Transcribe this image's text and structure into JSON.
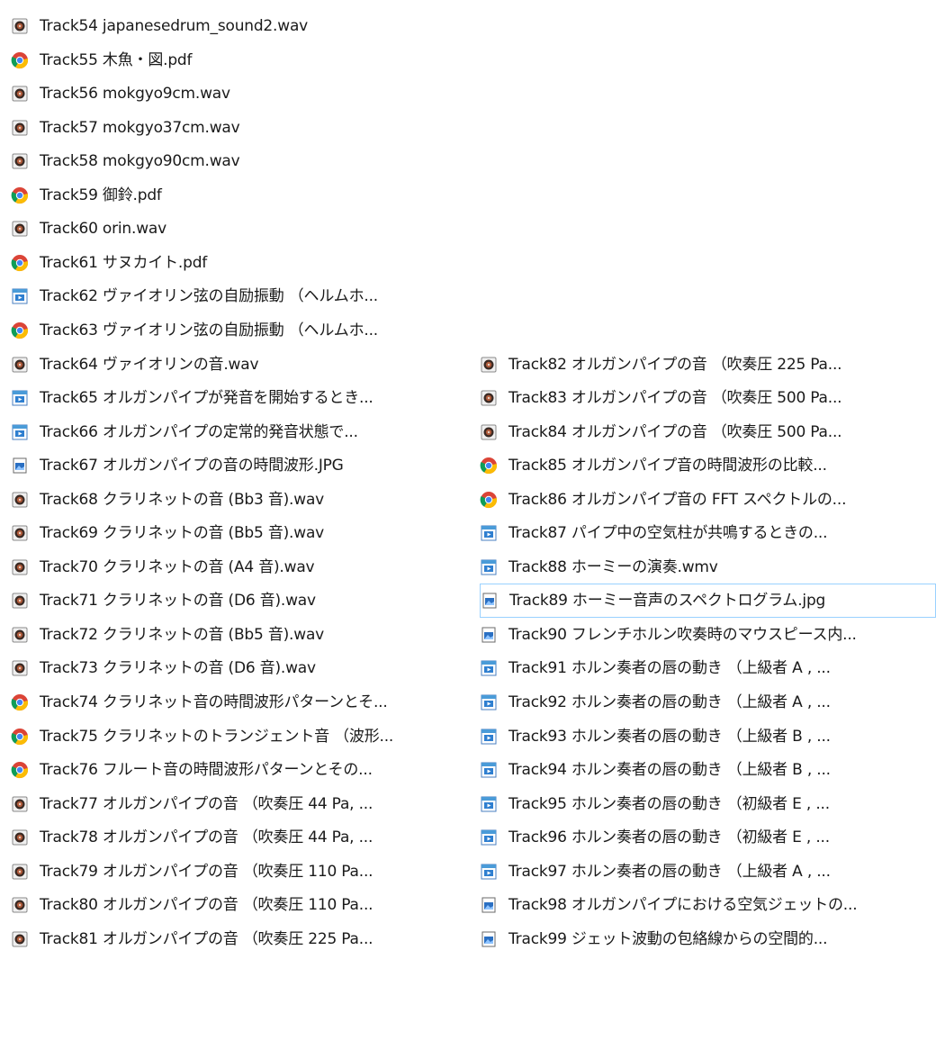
{
  "files": {
    "left": [
      {
        "name": "Track54 japanesedrum_sound2.wav",
        "type": "audio"
      },
      {
        "name": "Track55 木魚・図.pdf",
        "type": "pdf"
      },
      {
        "name": "Track56 mokgyo9cm.wav",
        "type": "audio"
      },
      {
        "name": "Track57 mokgyo37cm.wav",
        "type": "audio"
      },
      {
        "name": "Track58 mokgyo90cm.wav",
        "type": "audio"
      },
      {
        "name": "Track59 御鈴.pdf",
        "type": "pdf"
      },
      {
        "name": "Track60  orin.wav",
        "type": "audio"
      },
      {
        "name": "Track61 サヌカイト.pdf",
        "type": "pdf"
      },
      {
        "name": "Track62 ヴァイオリン弦の自励振動 （ヘルムホ...",
        "type": "video"
      },
      {
        "name": "Track63 ヴァイオリン弦の自励振動 （ヘルムホ...",
        "type": "pdf"
      },
      {
        "name": "Track64 ヴァイオリンの音.wav",
        "type": "audio"
      },
      {
        "name": "Track65  オルガンパイプが発音を開始するとき...",
        "type": "video"
      },
      {
        "name": "Track66  オルガンパイプの定常的発音状態で...",
        "type": "video"
      },
      {
        "name": "Track67 オルガンパイプの音の時間波形.JPG",
        "type": "image"
      },
      {
        "name": "Track68 クラリネットの音 (Bb3 音).wav",
        "type": "audio"
      },
      {
        "name": "Track69 クラリネットの音 (Bb5 音).wav",
        "type": "audio"
      },
      {
        "name": "Track70 クラリネットの音 (A4 音).wav",
        "type": "audio"
      },
      {
        "name": "Track71 クラリネットの音 (D6 音).wav",
        "type": "audio"
      },
      {
        "name": "Track72 クラリネットの音 (Bb5 音).wav",
        "type": "audio"
      },
      {
        "name": "Track73 クラリネットの音 (D6 音).wav",
        "type": "audio"
      },
      {
        "name": "Track74 クラリネット音の時間波形パターンとそ...",
        "type": "pdf"
      },
      {
        "name": "Track75 クラリネットのトランジェント音 （波形...",
        "type": "pdf"
      },
      {
        "name": "Track76 フルート音の時間波形パターンとその...",
        "type": "pdf"
      },
      {
        "name": "Track77 オルガンパイプの音 （吹奏圧 44 Pa, ...",
        "type": "audio"
      },
      {
        "name": "Track78 オルガンパイプの音 （吹奏圧 44 Pa, ...",
        "type": "audio"
      },
      {
        "name": "Track79 オルガンパイプの音 （吹奏圧 110 Pa...",
        "type": "audio"
      },
      {
        "name": "Track80 オルガンパイプの音 （吹奏圧 110 Pa...",
        "type": "audio"
      },
      {
        "name": "Track81 オルガンパイプの音 （吹奏圧 225 Pa...",
        "type": "audio"
      }
    ],
    "right": [
      {
        "name": "Track82 オルガンパイプの音 （吹奏圧 225 Pa...",
        "type": "audio"
      },
      {
        "name": "Track83 オルガンパイプの音 （吹奏圧 500 Pa...",
        "type": "audio"
      },
      {
        "name": "Track84 オルガンパイプの音 （吹奏圧 500 Pa...",
        "type": "audio"
      },
      {
        "name": "Track85 オルガンパイプ音の時間波形の比較...",
        "type": "pdf"
      },
      {
        "name": "Track86 オルガンパイプ音の FFT スペクトルの...",
        "type": "pdf"
      },
      {
        "name": "Track87 パイプ中の空気柱が共鳴するときの...",
        "type": "video"
      },
      {
        "name": "Track88 ホーミーの演奏.wmv",
        "type": "video"
      },
      {
        "name": "Track89 ホーミー音声のスペクトログラム.jpg",
        "type": "image",
        "selected": true
      },
      {
        "name": "Track90 フレンチホルン吹奏時のマウスピース内...",
        "type": "image"
      },
      {
        "name": "Track91 ホルン奏者の唇の動き （上級者 A , ...",
        "type": "video"
      },
      {
        "name": "Track92 ホルン奏者の唇の動き （上級者 A , ...",
        "type": "video"
      },
      {
        "name": "Track93 ホルン奏者の唇の動き （上級者 B , ...",
        "type": "video"
      },
      {
        "name": "Track94 ホルン奏者の唇の動き （上級者 B , ...",
        "type": "video"
      },
      {
        "name": "Track95 ホルン奏者の唇の動き （初級者 E , ...",
        "type": "video"
      },
      {
        "name": "Track96 ホルン奏者の唇の動き （初級者 E , ...",
        "type": "video"
      },
      {
        "name": "Track97 ホルン奏者の唇の動き （上級者 A , ...",
        "type": "video"
      },
      {
        "name": "Track98 オルガンパイプにおける空気ジェットの...",
        "type": "image"
      },
      {
        "name": "Track99 ジェット波動の包絡線からの空間的...",
        "type": "image"
      }
    ]
  },
  "icon_names": {
    "audio": "audio-file-icon",
    "pdf": "chrome-pdf-icon",
    "video": "video-file-icon",
    "image": "image-file-icon"
  }
}
